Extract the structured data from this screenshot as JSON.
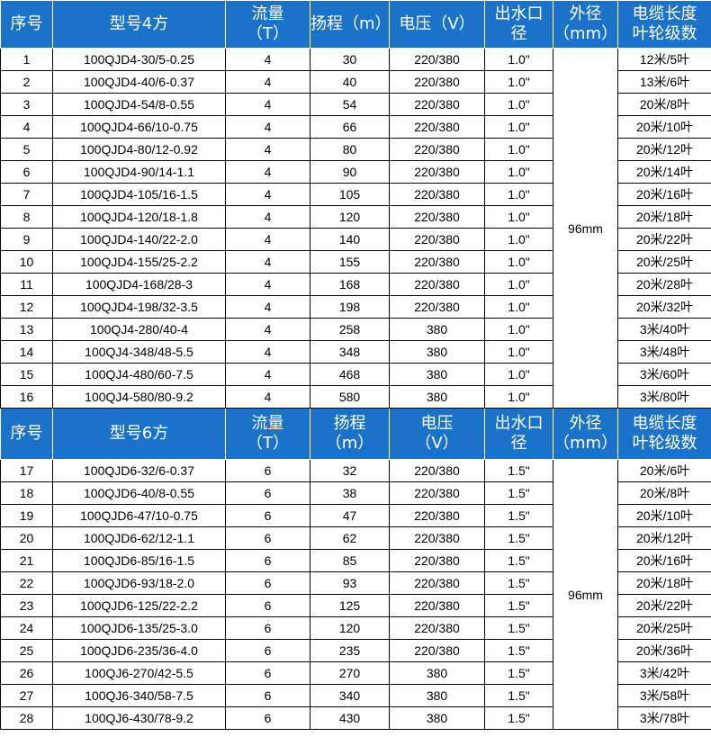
{
  "sections": [
    {
      "header": {
        "index": "序号",
        "model": "型号4方",
        "flow": [
          "流量",
          "（T）"
        ],
        "head": [
          "扬程（m）"
        ],
        "voltage": [
          "电压（V）"
        ],
        "outlet": [
          "出水口",
          "径"
        ],
        "diameter": [
          "外径",
          "（mm）"
        ],
        "cable": [
          "电缆长度",
          "叶轮级数"
        ]
      },
      "diameter_value": "96mm",
      "rows": [
        {
          "index": "1",
          "model": "100QJD4-30/5-0.25",
          "flow": "4",
          "head": "30",
          "voltage": "220/380",
          "outlet": "1.0\"",
          "cable": "12米/5叶"
        },
        {
          "index": "2",
          "model": "100QJD4-40/6-0.37",
          "flow": "4",
          "head": "40",
          "voltage": "220/380",
          "outlet": "1.0\"",
          "cable": "13米/6叶"
        },
        {
          "index": "3",
          "model": "100QJD4-54/8-0.55",
          "flow": "4",
          "head": "54",
          "voltage": "220/380",
          "outlet": "1.0\"",
          "cable": "20米/8叶"
        },
        {
          "index": "4",
          "model": "100QJD4-66/10-0.75",
          "flow": "4",
          "head": "66",
          "voltage": "220/380",
          "outlet": "1.0\"",
          "cable": "20米/10叶"
        },
        {
          "index": "5",
          "model": "100QJD4-80/12-0.92",
          "flow": "4",
          "head": "80",
          "voltage": "220/380",
          "outlet": "1.0\"",
          "cable": "20米/12叶"
        },
        {
          "index": "6",
          "model": "100QJD4-90/14-1.1",
          "flow": "4",
          "head": "90",
          "voltage": "220/380",
          "outlet": "1.0\"",
          "cable": "20米/14叶"
        },
        {
          "index": "7",
          "model": "100QJD4-105/16-1.5",
          "flow": "4",
          "head": "105",
          "voltage": "220/380",
          "outlet": "1.0\"",
          "cable": "20米/16叶"
        },
        {
          "index": "8",
          "model": "100QJD4-120/18-1.8",
          "flow": "4",
          "head": "120",
          "voltage": "220/380",
          "outlet": "1.0\"",
          "cable": "20米/18叶"
        },
        {
          "index": "9",
          "model": "100QJD4-140/22-2.0",
          "flow": "4",
          "head": "140",
          "voltage": "220/380",
          "outlet": "1.0\"",
          "cable": "20米/22叶"
        },
        {
          "index": "10",
          "model": "100QJD4-155/25-2.2",
          "flow": "4",
          "head": "155",
          "voltage": "220/380",
          "outlet": "1.0\"",
          "cable": "20米/25叶"
        },
        {
          "index": "11",
          "model": "100QJD4-168/28-3",
          "flow": "4",
          "head": "168",
          "voltage": "220/380",
          "outlet": "1.0\"",
          "cable": "20米/28叶"
        },
        {
          "index": "12",
          "model": "100QJD4-198/32-3.5",
          "flow": "4",
          "head": "198",
          "voltage": "220/380",
          "outlet": "1.0\"",
          "cable": "20米/32叶"
        },
        {
          "index": "13",
          "model": "100QJ4-280/40-4",
          "flow": "4",
          "head": "258",
          "voltage": "380",
          "outlet": "1.0\"",
          "cable": "3米/40叶"
        },
        {
          "index": "14",
          "model": "100QJ4-348/48-5.5",
          "flow": "4",
          "head": "348",
          "voltage": "380",
          "outlet": "1.0\"",
          "cable": "3米/48叶"
        },
        {
          "index": "15",
          "model": "100QJ4-480/60-7.5",
          "flow": "4",
          "head": "468",
          "voltage": "380",
          "outlet": "1.0\"",
          "cable": "3米/60叶"
        },
        {
          "index": "16",
          "model": "100QJ4-580/80-9.2",
          "flow": "4",
          "head": "580",
          "voltage": "380",
          "outlet": "1.0\"",
          "cable": "3米/80叶"
        }
      ]
    },
    {
      "header": {
        "index": "序号",
        "model": "型号6方",
        "flow": [
          "流量",
          "（T）"
        ],
        "head": [
          "扬程",
          "（m）"
        ],
        "voltage": [
          "电压",
          "（V）"
        ],
        "outlet": [
          "出水口",
          "径"
        ],
        "diameter": [
          "外径",
          "（mm）"
        ],
        "cable": [
          "电缆长度",
          "叶轮级数"
        ]
      },
      "diameter_value": "96mm",
      "rows": [
        {
          "index": "17",
          "model": "100QJD6-32/6-0.37",
          "flow": "6",
          "head": "32",
          "voltage": "220/380",
          "outlet": "1.5\"",
          "cable": "20米/6叶"
        },
        {
          "index": "18",
          "model": "100QJD6-40/8-0.55",
          "flow": "6",
          "head": "38",
          "voltage": "220/380",
          "outlet": "1.5\"",
          "cable": "20米/8叶"
        },
        {
          "index": "19",
          "model": "100QJD6-47/10-0.75",
          "flow": "6",
          "head": "47",
          "voltage": "220/380",
          "outlet": "1.5\"",
          "cable": "20米/10叶"
        },
        {
          "index": "20",
          "model": "100QJD6-62/12-1.1",
          "flow": "6",
          "head": "62",
          "voltage": "220/380",
          "outlet": "1.5\"",
          "cable": "20米/12叶"
        },
        {
          "index": "21",
          "model": "100QJD6-85/16-1.5",
          "flow": "6",
          "head": "85",
          "voltage": "220/380",
          "outlet": "1.5\"",
          "cable": "20米/16叶"
        },
        {
          "index": "22",
          "model": "100QJD6-93/18-2.0",
          "flow": "6",
          "head": "93",
          "voltage": "220/380",
          "outlet": "1.5\"",
          "cable": "20米/18叶"
        },
        {
          "index": "23",
          "model": "100QJD6-125/22-2.2",
          "flow": "6",
          "head": "125",
          "voltage": "220/380",
          "outlet": "1.5\"",
          "cable": "20米/22叶"
        },
        {
          "index": "24",
          "model": "100QJD6-135/25-3.0",
          "flow": "6",
          "head": "120",
          "voltage": "220/380",
          "outlet": "1.5\"",
          "cable": "20米/25叶"
        },
        {
          "index": "25",
          "model": "100QJD6-235/36-4.0",
          "flow": "6",
          "head": "235",
          "voltage": "220/380",
          "outlet": "1.5\"",
          "cable": "20米/36叶"
        },
        {
          "index": "26",
          "model": "100QJ6-270/42-5.5",
          "flow": "6",
          "head": "270",
          "voltage": "380",
          "outlet": "1.5\"",
          "cable": "3米/42叶"
        },
        {
          "index": "27",
          "model": "100QJ6-340/58-7.5",
          "flow": "6",
          "head": "340",
          "voltage": "380",
          "outlet": "1.5\"",
          "cable": "3米/58叶"
        },
        {
          "index": "28",
          "model": "100QJ6-430/78-9.2",
          "flow": "6",
          "head": "430",
          "voltage": "380",
          "outlet": "1.5\"",
          "cable": "3米/78叶"
        }
      ]
    }
  ]
}
